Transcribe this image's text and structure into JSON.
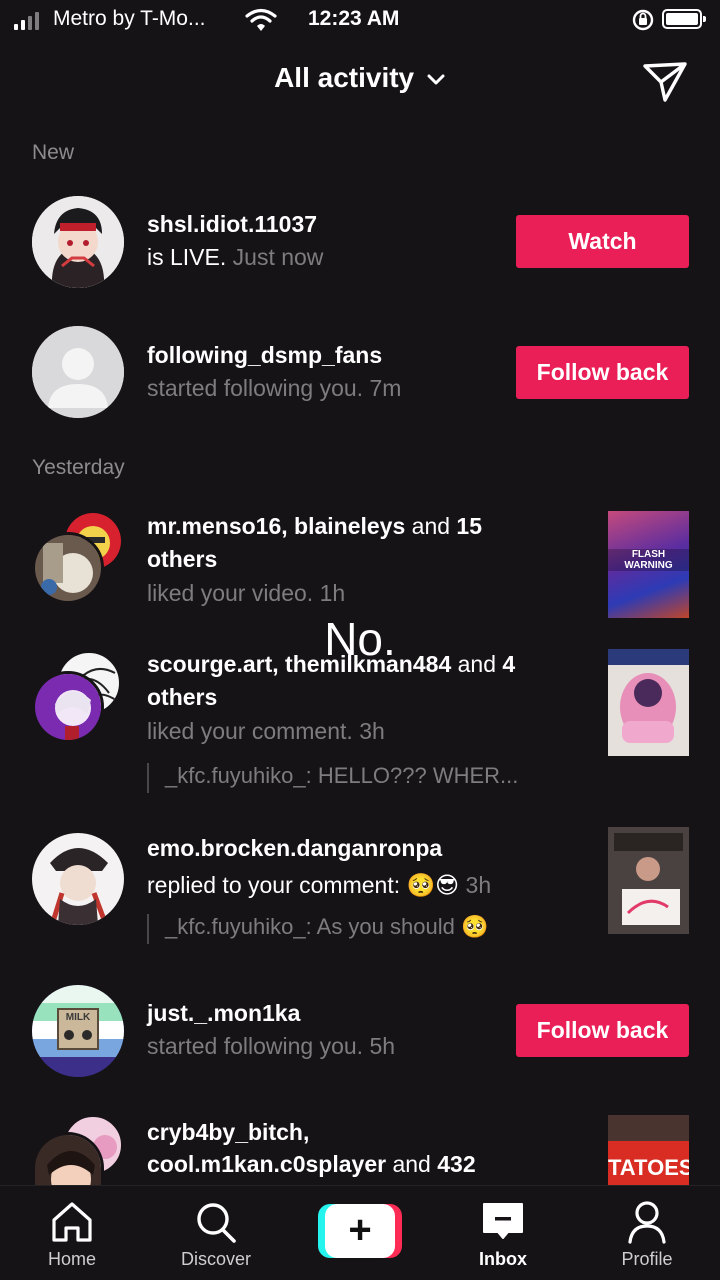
{
  "status_bar": {
    "carrier": "Metro by T-Mo...",
    "time": "12:23 AM"
  },
  "header": {
    "title": "All activity",
    "dropdown_icon": "chevron-down-icon",
    "send_icon": "paper-plane-icon"
  },
  "sections": {
    "new": "New",
    "yesterday": "Yesterday"
  },
  "activities": [
    {
      "username": "shsl.idiot.11037",
      "action": "is LIVE.",
      "time": "Just now",
      "button": "Watch"
    },
    {
      "username": "following_dsmp_fans",
      "action": "started following you.",
      "time": "7m",
      "button": "Follow back"
    },
    {
      "user1": "mr.menso16",
      "sep": ", ",
      "user2": "blaineleys",
      "and": "and",
      "count": "15",
      "others": "others",
      "action": "liked your video.",
      "time": "1h",
      "thumb_text": "FLASH WARNING"
    },
    {
      "user1": "scourge.art",
      "sep": ", ",
      "user2": "themilkman484",
      "and": "and",
      "count": "4",
      "others": "others",
      "action": "liked your comment.",
      "time": "3h",
      "quote": "_kfc.fuyuhiko_: HELLO??? WHER..."
    },
    {
      "username": "emo.brocken.danganronpa",
      "action": "replied to your comment:",
      "emoji": "🥺😎",
      "time": "3h",
      "quote": "_kfc.fuyuhiko_: As you should 🥺"
    },
    {
      "username": "just._.mon1ka",
      "action": "started following you.",
      "time": "5h",
      "button": "Follow back",
      "avatar_text": "MILK"
    },
    {
      "user1": "cryb4by_bitch,",
      "user2": "cool.m1kan.c0splayer",
      "and": "and",
      "count": "432",
      "thumb_text": "TATOES"
    }
  ],
  "overlay_caption": "No.",
  "tabs": [
    {
      "label": "Home",
      "icon": "home-icon"
    },
    {
      "label": "Discover",
      "icon": "search-icon"
    },
    {
      "label": "",
      "icon": "plus-icon"
    },
    {
      "label": "Inbox",
      "icon": "inbox-icon"
    },
    {
      "label": "Profile",
      "icon": "profile-icon"
    }
  ],
  "colors": {
    "background": "#161316",
    "accent": "#ea1f58",
    "secondary_text": "#7f7c80"
  }
}
